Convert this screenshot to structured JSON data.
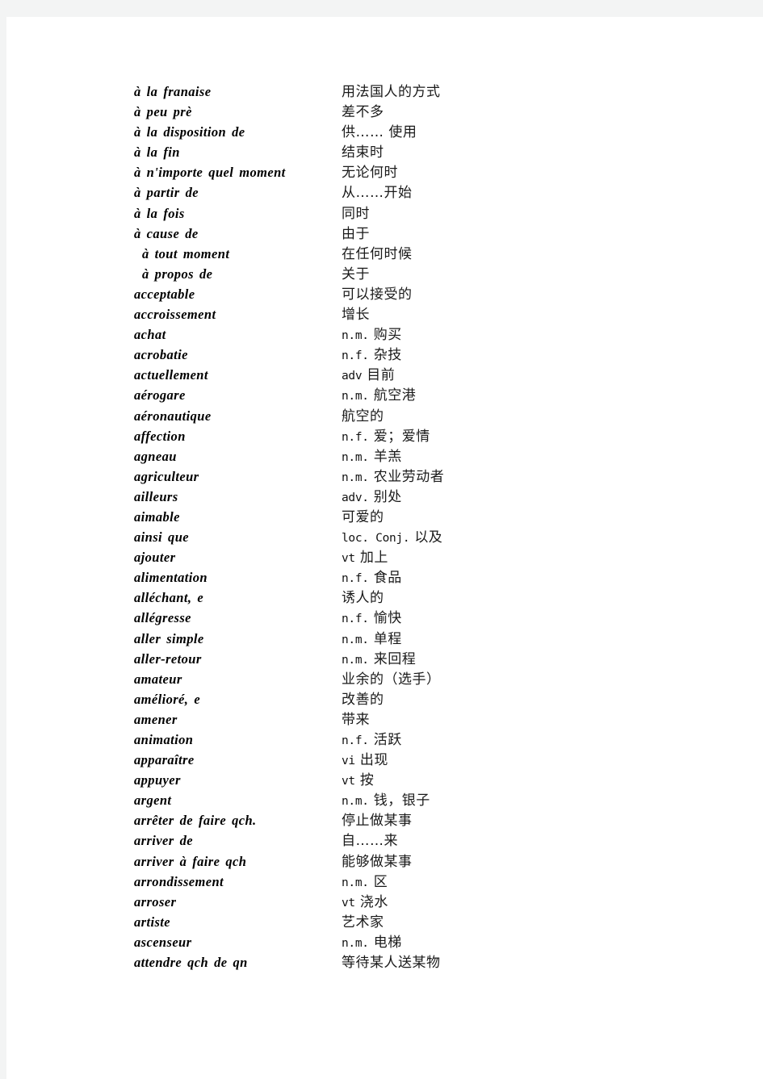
{
  "page": {
    "background_color": "#ffffff",
    "outer_color": "#f3f4f4",
    "language_pair": "French-Chinese"
  },
  "entries": [
    {
      "term": "à  la  franɑise",
      "indented": false,
      "pos": "",
      "cn": "用法国人的方式"
    },
    {
      "term": "à  peu  prè",
      "indented": false,
      "pos": "",
      "cn": "差不多"
    },
    {
      "term": "à  la  disposition  de",
      "indented": false,
      "pos": "",
      "cn": "供…… 使用"
    },
    {
      "term": "à  la  fin",
      "indented": false,
      "pos": "",
      "cn": "结束时"
    },
    {
      "term": "à  n'importe  quel  moment",
      "indented": false,
      "pos": "",
      "cn": "无论何时"
    },
    {
      "term": "à  partir  de",
      "indented": false,
      "pos": "",
      "cn": "从……开始"
    },
    {
      "term": "à  la  fois",
      "indented": false,
      "pos": "",
      "cn": "同时"
    },
    {
      "term": "à  cause  de",
      "indented": false,
      "pos": "",
      "cn": "由于"
    },
    {
      "term": "à  tout  moment",
      "indented": true,
      "pos": "",
      "cn": "在任何时候"
    },
    {
      "term": "à  propos  de",
      "indented": true,
      "pos": "",
      "cn": "关于"
    },
    {
      "term": "acceptable",
      "indented": false,
      "pos": "",
      "cn": "可以接受的"
    },
    {
      "term": "accroissement",
      "indented": false,
      "pos": "",
      "cn": "增长"
    },
    {
      "term": "achat",
      "indented": false,
      "pos": "n.m.",
      "cn": "购买"
    },
    {
      "term": "acrobatie",
      "indented": false,
      "pos": "n.f.",
      "cn": "杂技"
    },
    {
      "term": "actuellement",
      "indented": false,
      "pos": "adv",
      "cn": "目前"
    },
    {
      "term": "aérogare",
      "indented": false,
      "pos": "n.m.",
      "cn": "航空港"
    },
    {
      "term": "aéronautique",
      "indented": false,
      "pos": "",
      "cn": "航空的"
    },
    {
      "term": "affection",
      "indented": false,
      "pos": "n.f.",
      "cn": "爱；爱情"
    },
    {
      "term": "agneau",
      "indented": false,
      "pos": "n.m.",
      "cn": "羊羔"
    },
    {
      "term": "agriculteur",
      "indented": false,
      "pos": "n.m.",
      "cn": "农业劳动者"
    },
    {
      "term": "ailleurs",
      "indented": false,
      "pos": "adv.",
      "cn": "别处"
    },
    {
      "term": "aimable",
      "indented": false,
      "pos": "",
      "cn": "可爱的"
    },
    {
      "term": "ainsi  que",
      "indented": false,
      "pos": "loc. Conj.",
      "cn": "以及"
    },
    {
      "term": "ajouter",
      "indented": false,
      "pos": "vt",
      "cn": "加上"
    },
    {
      "term": "alimentation",
      "indented": false,
      "pos": "n.f.",
      "cn": "食品"
    },
    {
      "term": "alléchant, e",
      "indented": false,
      "pos": "",
      "cn": "诱人的"
    },
    {
      "term": "allégresse",
      "indented": false,
      "pos": "n.f.",
      "cn": "愉快"
    },
    {
      "term": "aller  simple",
      "indented": false,
      "pos": "n.m.",
      "cn": "单程"
    },
    {
      "term": "aller-retour",
      "indented": false,
      "pos": "n.m.",
      "cn": "来回程"
    },
    {
      "term": "amateur",
      "indented": false,
      "pos": "",
      "cn": "业余的（选手）"
    },
    {
      "term": "amélioré, e",
      "indented": false,
      "pos": "",
      "cn": "改善的"
    },
    {
      "term": "amener",
      "indented": false,
      "pos": "",
      "cn": "带来"
    },
    {
      "term": "animation",
      "indented": false,
      "pos": "n.f.",
      "cn": "活跃"
    },
    {
      "term": "apparaître",
      "indented": false,
      "pos": "vi",
      "cn": "出现"
    },
    {
      "term": "appuyer",
      "indented": false,
      "pos": "vt",
      "cn": "按"
    },
    {
      "term": "argent",
      "indented": false,
      "pos": "n.m.",
      "cn": "钱，银子"
    },
    {
      "term": "arrêter  de  faire  qch.",
      "indented": false,
      "pos": "",
      "cn": "停止做某事"
    },
    {
      "term": "arriver  de",
      "indented": false,
      "pos": "",
      "cn": "自……来"
    },
    {
      "term": "arriver  à faire  qch",
      "indented": false,
      "pos": "",
      "cn": "能够做某事"
    },
    {
      "term": "arrondissement",
      "indented": false,
      "pos": "n.m.",
      "cn": "区"
    },
    {
      "term": "arroser",
      "indented": false,
      "pos": "vt",
      "cn": "浇水"
    },
    {
      "term": "artiste",
      "indented": false,
      "pos": "",
      "cn": "艺术家"
    },
    {
      "term": "ascenseur",
      "indented": false,
      "pos": "n.m.",
      "cn": "电梯"
    },
    {
      "term": "attendre  qch  de  qn",
      "indented": false,
      "pos": "",
      "cn": "等待某人送某物"
    }
  ]
}
